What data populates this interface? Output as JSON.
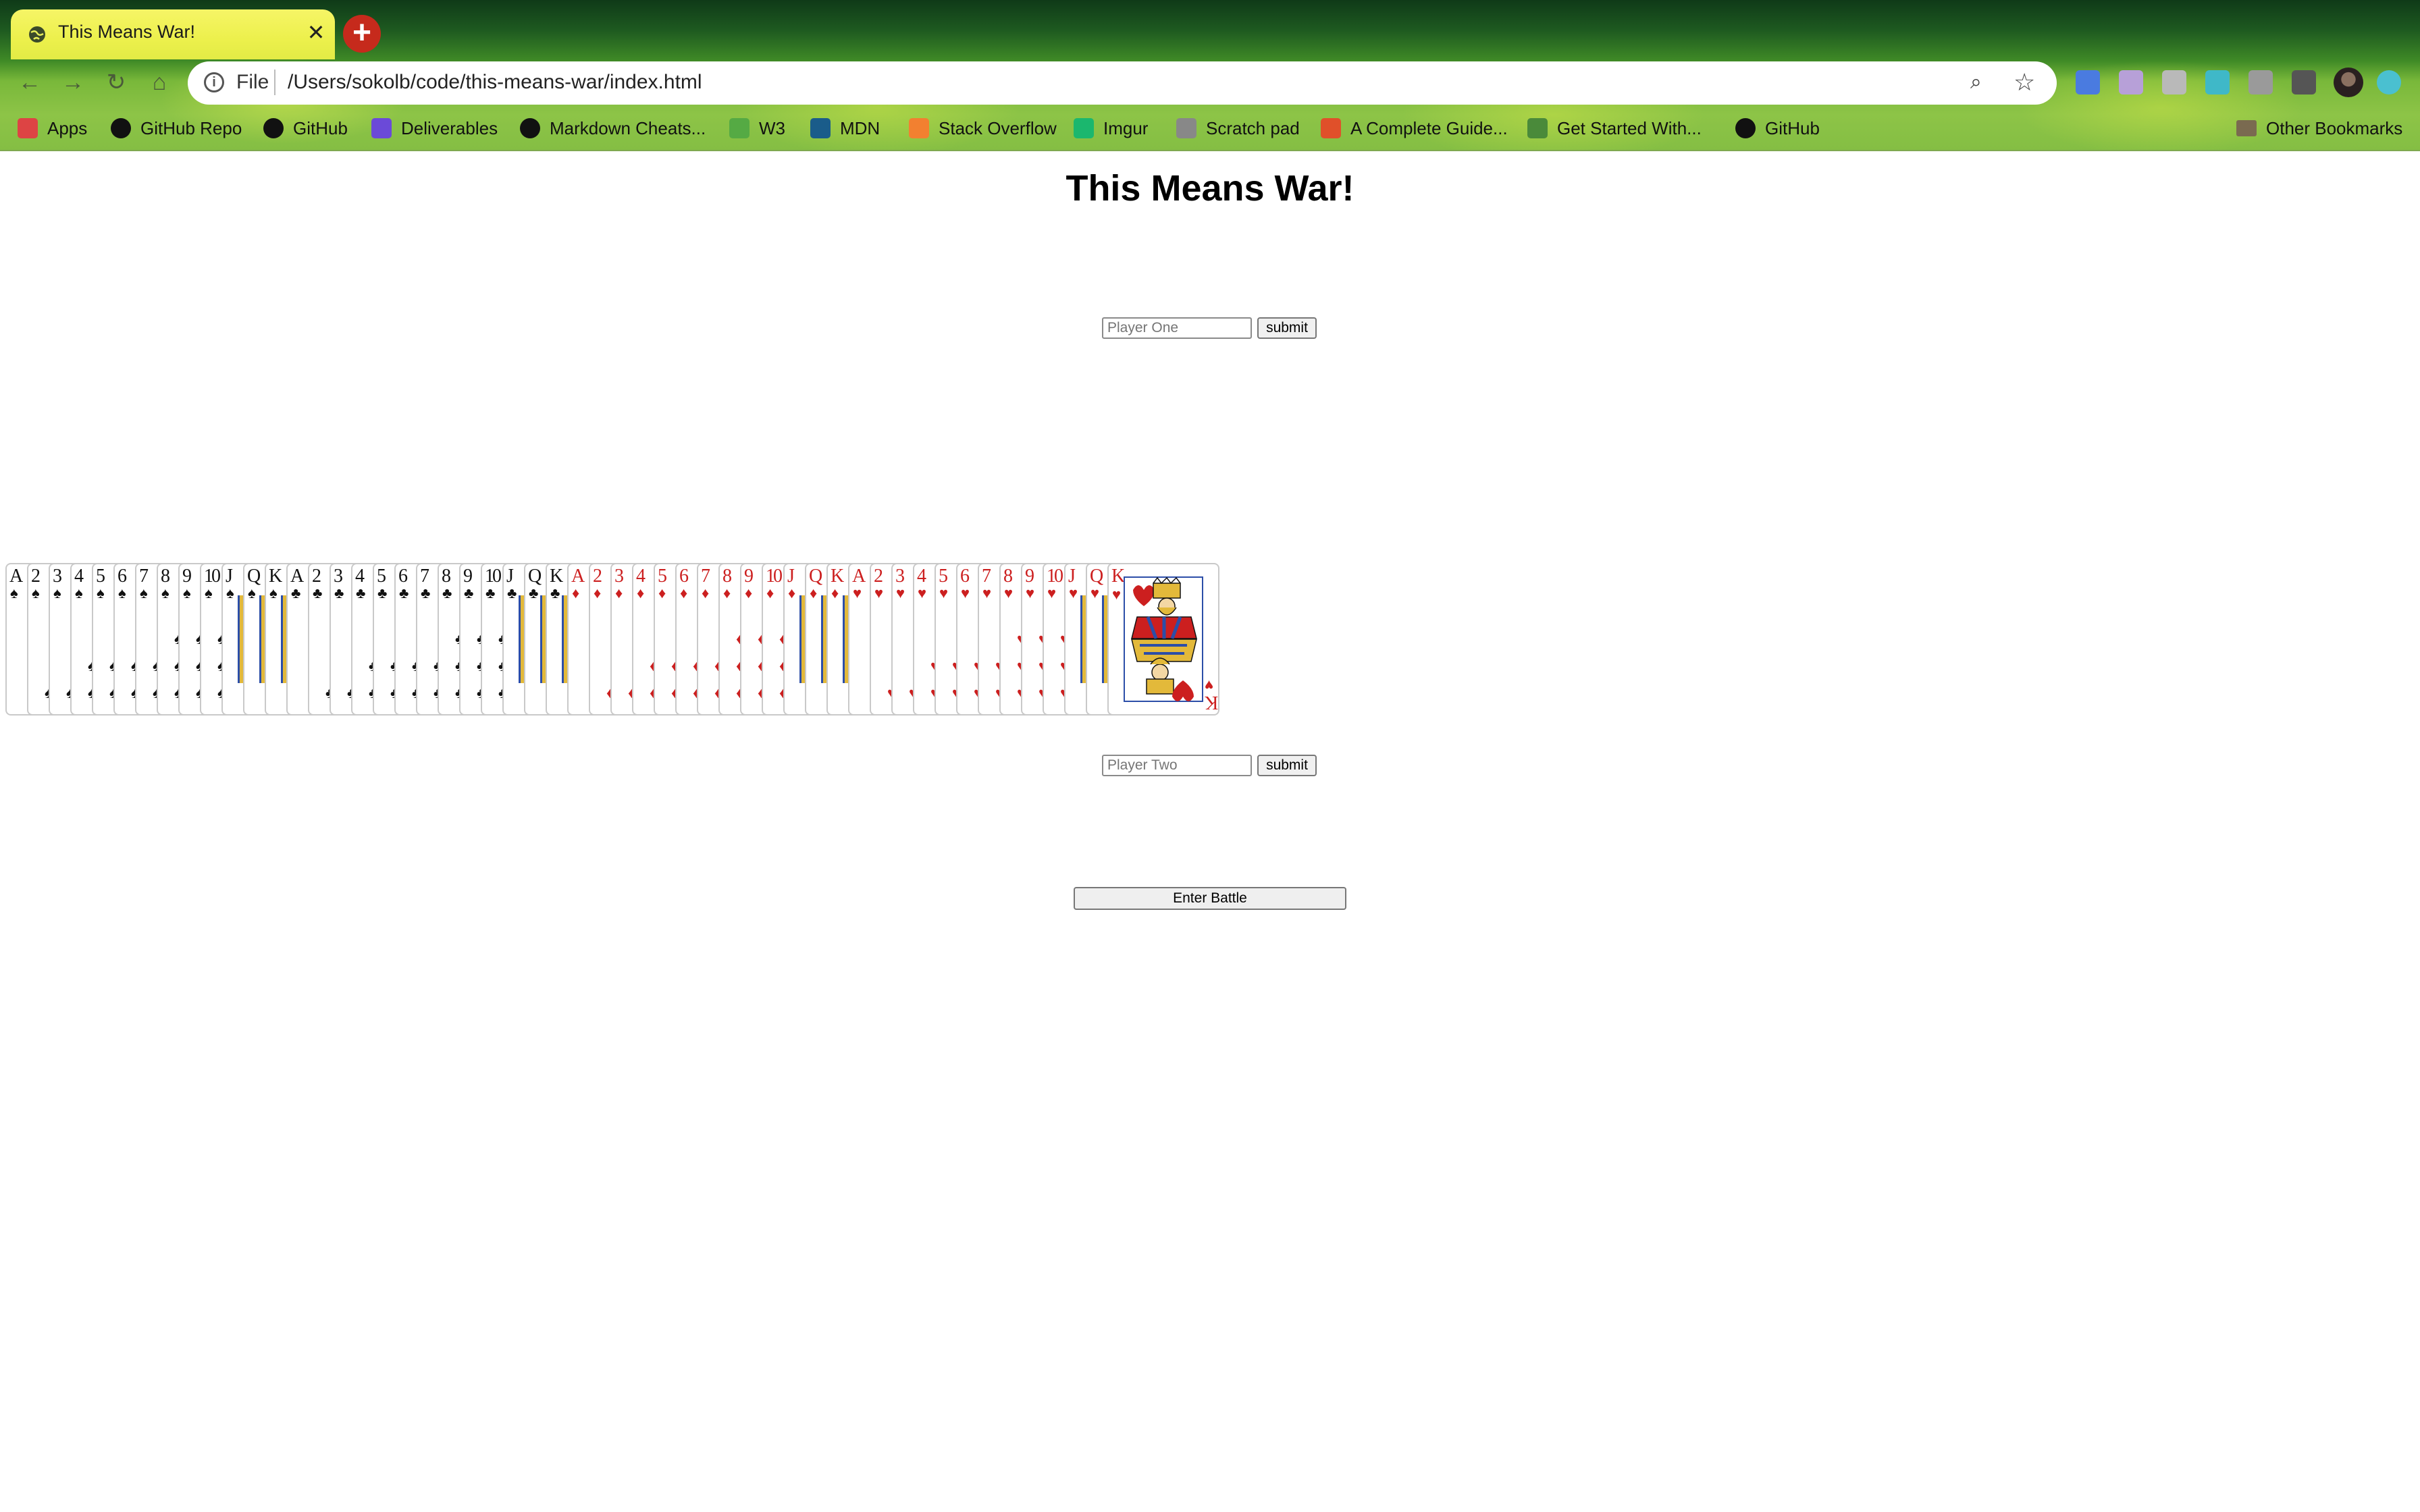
{
  "browser": {
    "tab_title": "This Means War!",
    "tab_close": "✕",
    "new_tab": "+",
    "nav": {
      "back": "←",
      "forward": "→",
      "reload": "↻",
      "home": "⌂"
    },
    "address": {
      "scheme": "File",
      "url": "/Users/sokolb/code/this-means-war/index.html"
    },
    "zoom_icon": "⌕",
    "star_icon": "☆",
    "extensions": [
      {
        "name": "translate-extension-icon",
        "color": "#4a7be0"
      },
      {
        "name": "extension-icon-2",
        "color": "#b7a0d8"
      },
      {
        "name": "extension-icon-3",
        "color": "#b9b9b9"
      },
      {
        "name": "sync-extension-icon",
        "color": "#3fb8c8"
      },
      {
        "name": "extension-icon-5",
        "color": "#9a9a9a"
      },
      {
        "name": "puzzle-extension-icon",
        "color": "#555555"
      }
    ],
    "bookmarks": [
      {
        "label": "Apps",
        "icon": "apps-icon",
        "color": "#d44"
      },
      {
        "label": "GitHub Repo",
        "icon": "github-icon",
        "color": "#111"
      },
      {
        "label": "GitHub",
        "icon": "github-icon",
        "color": "#111"
      },
      {
        "label": "Deliverables",
        "icon": "list-icon",
        "color": "#6b4ad8"
      },
      {
        "label": "Markdown Cheats...",
        "icon": "github-icon",
        "color": "#111"
      },
      {
        "label": "W3",
        "icon": "w3-icon",
        "color": "#55aa44"
      },
      {
        "label": "MDN",
        "icon": "mdn-icon",
        "color": "#1a5c8a"
      },
      {
        "label": "Stack Overflow",
        "icon": "stackoverflow-icon",
        "color": "#f28030"
      },
      {
        "label": "Imgur",
        "icon": "imgur-icon",
        "color": "#1bb76e"
      },
      {
        "label": "Scratch pad",
        "icon": "globe-icon",
        "color": "#888"
      },
      {
        "label": "A Complete Guide...",
        "icon": "csstricks-icon",
        "color": "#e0502a"
      },
      {
        "label": "Get Started With...",
        "icon": "code-icon",
        "color": "#4a8a3a"
      },
      {
        "label": "GitHub",
        "icon": "github-icon",
        "color": "#111"
      }
    ],
    "other_bookmarks": "Other Bookmarks"
  },
  "page": {
    "title": "This Means War!",
    "player_one_placeholder": "Player One",
    "player_two_placeholder": "Player Two",
    "submit_label": "submit",
    "enter_battle_label": "Enter Battle"
  },
  "deck": {
    "cards": [
      {
        "rank": "A",
        "suit": "♠",
        "color": "black"
      },
      {
        "rank": "2",
        "suit": "♠",
        "color": "black"
      },
      {
        "rank": "3",
        "suit": "♠",
        "color": "black"
      },
      {
        "rank": "4",
        "suit": "♠",
        "color": "black"
      },
      {
        "rank": "5",
        "suit": "♠",
        "color": "black"
      },
      {
        "rank": "6",
        "suit": "♠",
        "color": "black"
      },
      {
        "rank": "7",
        "suit": "♠",
        "color": "black"
      },
      {
        "rank": "8",
        "suit": "♠",
        "color": "black"
      },
      {
        "rank": "9",
        "suit": "♠",
        "color": "black"
      },
      {
        "rank": "10",
        "suit": "♠",
        "color": "black"
      },
      {
        "rank": "J",
        "suit": "♠",
        "color": "black",
        "face": true
      },
      {
        "rank": "Q",
        "suit": "♠",
        "color": "black",
        "face": true
      },
      {
        "rank": "K",
        "suit": "♠",
        "color": "black",
        "face": true
      },
      {
        "rank": "A",
        "suit": "♣",
        "color": "black"
      },
      {
        "rank": "2",
        "suit": "♣",
        "color": "black"
      },
      {
        "rank": "3",
        "suit": "♣",
        "color": "black"
      },
      {
        "rank": "4",
        "suit": "♣",
        "color": "black"
      },
      {
        "rank": "5",
        "suit": "♣",
        "color": "black"
      },
      {
        "rank": "6",
        "suit": "♣",
        "color": "black"
      },
      {
        "rank": "7",
        "suit": "♣",
        "color": "black"
      },
      {
        "rank": "8",
        "suit": "♣",
        "color": "black"
      },
      {
        "rank": "9",
        "suit": "♣",
        "color": "black"
      },
      {
        "rank": "10",
        "suit": "♣",
        "color": "black"
      },
      {
        "rank": "J",
        "suit": "♣",
        "color": "black",
        "face": true
      },
      {
        "rank": "Q",
        "suit": "♣",
        "color": "black",
        "face": true
      },
      {
        "rank": "K",
        "suit": "♣",
        "color": "black",
        "face": true
      },
      {
        "rank": "A",
        "suit": "♦",
        "color": "red"
      },
      {
        "rank": "2",
        "suit": "♦",
        "color": "red"
      },
      {
        "rank": "3",
        "suit": "♦",
        "color": "red"
      },
      {
        "rank": "4",
        "suit": "♦",
        "color": "red"
      },
      {
        "rank": "5",
        "suit": "♦",
        "color": "red"
      },
      {
        "rank": "6",
        "suit": "♦",
        "color": "red"
      },
      {
        "rank": "7",
        "suit": "♦",
        "color": "red"
      },
      {
        "rank": "8",
        "suit": "♦",
        "color": "red"
      },
      {
        "rank": "9",
        "suit": "♦",
        "color": "red"
      },
      {
        "rank": "10",
        "suit": "♦",
        "color": "red"
      },
      {
        "rank": "J",
        "suit": "♦",
        "color": "red",
        "face": true
      },
      {
        "rank": "Q",
        "suit": "♦",
        "color": "red",
        "face": true
      },
      {
        "rank": "K",
        "suit": "♦",
        "color": "red",
        "face": true
      },
      {
        "rank": "A",
        "suit": "♥",
        "color": "red"
      },
      {
        "rank": "2",
        "suit": "♥",
        "color": "red"
      },
      {
        "rank": "3",
        "suit": "♥",
        "color": "red"
      },
      {
        "rank": "4",
        "suit": "♥",
        "color": "red"
      },
      {
        "rank": "5",
        "suit": "♥",
        "color": "red"
      },
      {
        "rank": "6",
        "suit": "♥",
        "color": "red"
      },
      {
        "rank": "7",
        "suit": "♥",
        "color": "red"
      },
      {
        "rank": "8",
        "suit": "♥",
        "color": "red"
      },
      {
        "rank": "9",
        "suit": "♥",
        "color": "red"
      },
      {
        "rank": "10",
        "suit": "♥",
        "color": "red"
      },
      {
        "rank": "J",
        "suit": "♥",
        "color": "red",
        "face": true
      },
      {
        "rank": "Q",
        "suit": "♥",
        "color": "red",
        "face": true
      }
    ],
    "top_card": {
      "rank": "K",
      "suit": "♥",
      "color": "red"
    }
  }
}
